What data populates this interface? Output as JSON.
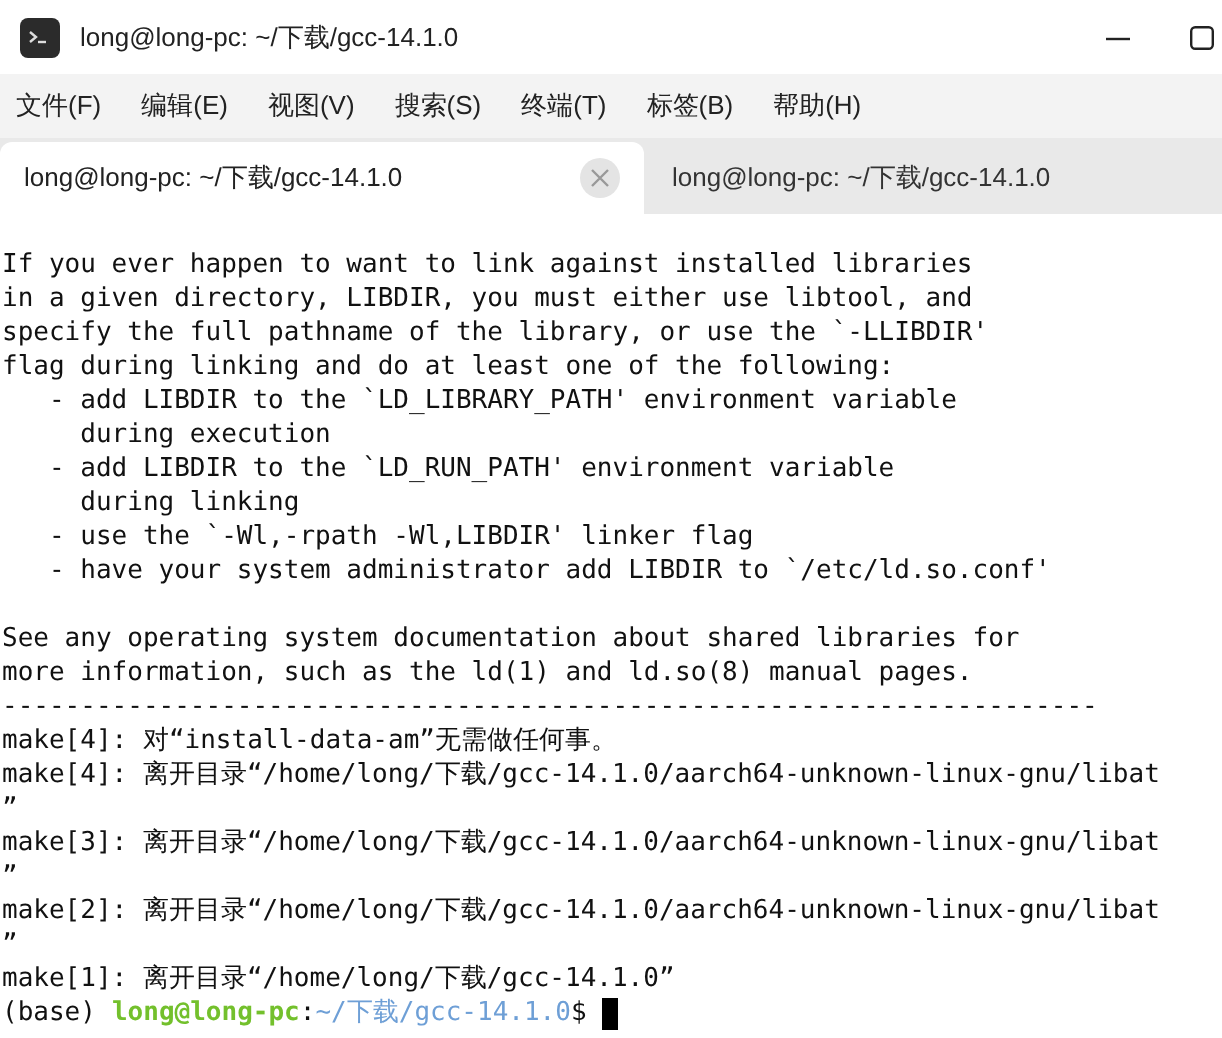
{
  "window": {
    "title": "long@long-pc: ~/下载/gcc-14.1.0"
  },
  "menu": [
    "文件(F)",
    "编辑(E)",
    "视图(V)",
    "搜索(S)",
    "终端(T)",
    "标签(B)",
    "帮助(H)"
  ],
  "tabs": [
    {
      "label": "long@long-pc: ~/下载/gcc-14.1.0",
      "selected": true
    },
    {
      "label": "long@long-pc: ~/下载/gcc-14.1.0",
      "selected": false
    }
  ],
  "terminal": {
    "lines": [
      {
        "kind": "text",
        "text": "If you ever happen to want to link against installed libraries"
      },
      {
        "kind": "text",
        "text": "in a given directory, LIBDIR, you must either use libtool, and"
      },
      {
        "kind": "text",
        "text": "specify the full pathname of the library, or use the `-LLIBDIR'"
      },
      {
        "kind": "text",
        "text": "flag during linking and do at least one of the following:"
      },
      {
        "kind": "text",
        "text": "   - add LIBDIR to the `LD_LIBRARY_PATH' environment variable"
      },
      {
        "kind": "text",
        "text": "     during execution"
      },
      {
        "kind": "text",
        "text": "   - add LIBDIR to the `LD_RUN_PATH' environment variable"
      },
      {
        "kind": "text",
        "text": "     during linking"
      },
      {
        "kind": "text",
        "text": "   - use the `-Wl,-rpath -Wl,LIBDIR' linker flag"
      },
      {
        "kind": "text",
        "text": "   - have your system administrator add LIBDIR to `/etc/ld.so.conf'"
      },
      {
        "kind": "blank"
      },
      {
        "kind": "text",
        "text": "See any operating system documentation about shared libraries for"
      },
      {
        "kind": "text",
        "text": "more information, such as the ld(1) and ld.so(8) manual pages."
      },
      {
        "kind": "text",
        "text": "----------------------------------------------------------------------"
      },
      {
        "kind": "text",
        "text": "make[4]: 对“install-data-am”无需做任何事。"
      },
      {
        "kind": "text",
        "text": "make[4]: 离开目录“/home/long/下载/gcc-14.1.0/aarch64-unknown-linux-gnu/libat"
      },
      {
        "kind": "text",
        "text": "”"
      },
      {
        "kind": "text",
        "text": "make[3]: 离开目录“/home/long/下载/gcc-14.1.0/aarch64-unknown-linux-gnu/libat"
      },
      {
        "kind": "text",
        "text": "”"
      },
      {
        "kind": "text",
        "text": "make[2]: 离开目录“/home/long/下载/gcc-14.1.0/aarch64-unknown-linux-gnu/libat"
      },
      {
        "kind": "text",
        "text": "”"
      },
      {
        "kind": "text",
        "text": "make[1]: 离开目录“/home/long/下载/gcc-14.1.0”"
      },
      {
        "kind": "prompt",
        "env": "(base)",
        "user": "long@long-pc",
        "separator": ":",
        "path": "~/下载/gcc-14.1.0",
        "symbol": "$",
        "cursor": true
      }
    ]
  }
}
